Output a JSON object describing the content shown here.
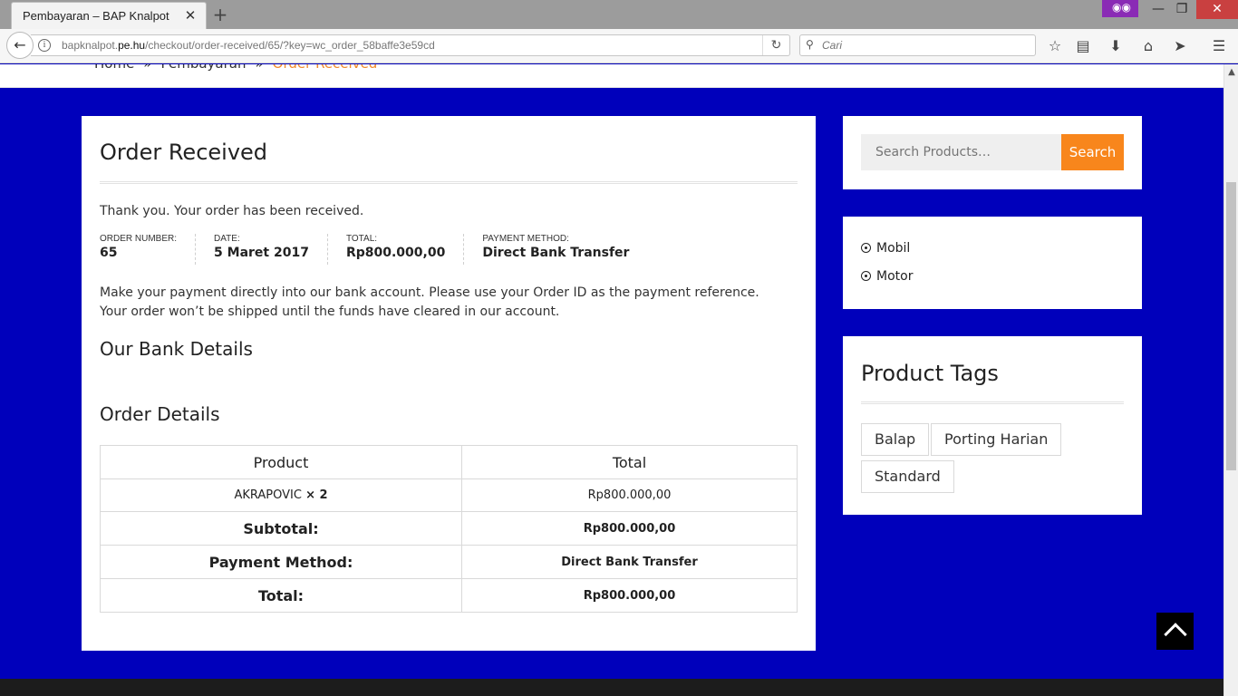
{
  "browser": {
    "tab_title": "Pembayaran – BAP Knalpot",
    "url_prefix": "bapknalpot.",
    "url_domain": "pe.hu",
    "url_path": "/checkout/order-received/65/?key=wc_order_58baffe3e59cd",
    "search_placeholder": "Cari"
  },
  "breadcrumb": {
    "home": "Home",
    "sep": "»",
    "checkout": "Pembayaran",
    "current": "Order Received"
  },
  "order": {
    "heading": "Order Received",
    "thanks": "Thank you. Your order has been received.",
    "overview": [
      {
        "label": "Order Number:",
        "value": "65"
      },
      {
        "label": "Date:",
        "value": "5 Maret 2017"
      },
      {
        "label": "Total:",
        "value": "Rp800.000,00"
      },
      {
        "label": "Payment Method:",
        "value": "Direct Bank Transfer"
      }
    ],
    "payment_note": "Make your payment directly into our bank account. Please use your Order ID as the payment reference. Your order won’t be shipped until the funds have cleared in our account.",
    "bank_heading": "Our Bank Details",
    "details_heading": "Order Details",
    "table": {
      "col_product": "Product",
      "col_total": "Total",
      "item_name": "AKRAPOVIC",
      "item_qty": "× 2",
      "item_total": "Rp800.000,00",
      "subtotal_label": "Subtotal:",
      "subtotal_value": "Rp800.000,00",
      "payment_label": "Payment Method:",
      "payment_value": "Direct Bank Transfer",
      "total_label": "Total:",
      "total_value": "Rp800.000,00"
    }
  },
  "sidebar": {
    "search_placeholder": "Search Products…",
    "search_button": "Search",
    "categories": [
      "Mobil",
      "Motor"
    ],
    "tags_heading": "Product Tags",
    "tags": [
      "Balap",
      "Porting Harian",
      "Standard"
    ]
  },
  "colors": {
    "page_bg": "#0000bb",
    "accent": "#f8861c",
    "breadcrumb_current": "#f28b2b"
  }
}
